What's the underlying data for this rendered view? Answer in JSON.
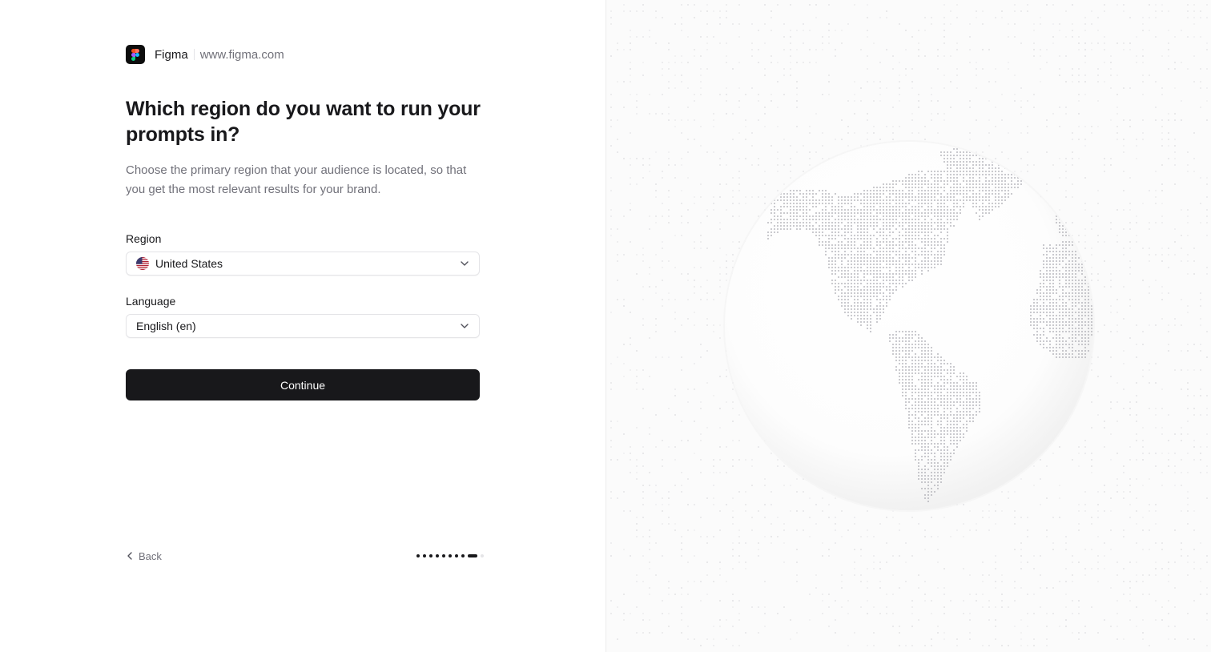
{
  "brand": {
    "name": "Figma",
    "url": "www.figma.com"
  },
  "page": {
    "title": "Which region do you want to run your prompts in?",
    "subtitle": "Choose the primary region that your audience is located, so that you get the most relevant results for your brand."
  },
  "form": {
    "region": {
      "label": "Region",
      "value": "United States",
      "flag_icon": "us-flag-icon"
    },
    "language": {
      "label": "Language",
      "value": "English (en)"
    },
    "continue_label": "Continue"
  },
  "footer": {
    "back_label": "Back",
    "progress": {
      "total_steps": 10,
      "current_step": 9
    }
  },
  "illustration": {
    "icon": "globe-americas-dotted-icon"
  },
  "colors": {
    "primary": "#18181b",
    "muted_text": "#71717a",
    "border": "#e4e4e7",
    "panel_bg": "#fbfbfb"
  }
}
